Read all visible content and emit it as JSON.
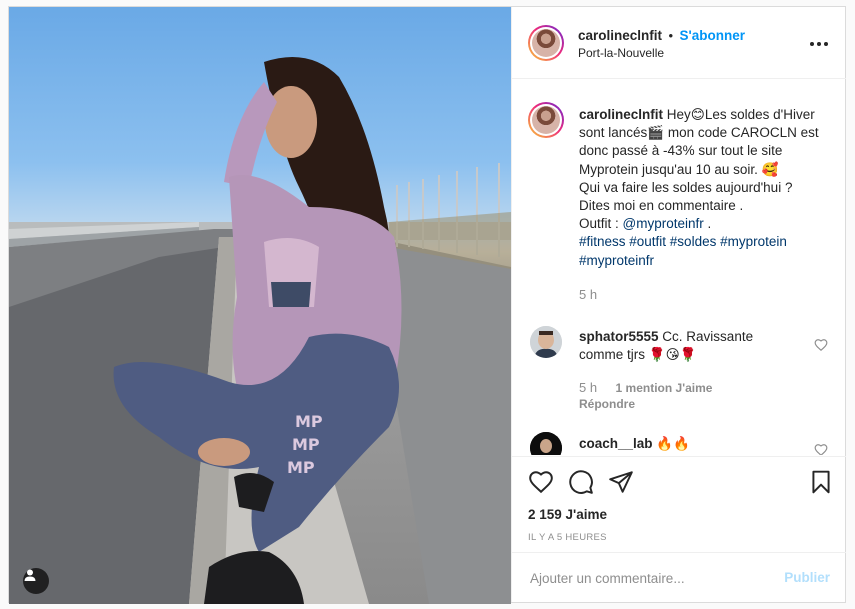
{
  "post": {
    "username": "carolineclnfit",
    "separator": "•",
    "follow_label": "S'abonner",
    "location": "Port-la-Nouvelle"
  },
  "caption": {
    "username": "carolineclnfit",
    "line1": " Hey😊Les soldes d'Hiver sont lancés🎬 mon code CAROCLN est donc passé à -43% sur tout le site Myprotein jusqu'au 10 au soir. 🥰",
    "line2": "Qui va faire les soldes aujourd'hui ?",
    "line3": "Dites moi en commentaire .",
    "outfit_label": "Outfit : ",
    "outfit_mention": "@myproteinfr",
    "outfit_end": " .",
    "hashtags1": "#fitness #outfit #soldes #myprotein",
    "hashtags2": "#myproteinfr",
    "time": "5 h"
  },
  "comments": [
    {
      "username": "sphator5555",
      "text": " Cc. Ravissante comme tjrs 🌹😘🌹",
      "time": "5 h",
      "likes": "1 mention J'aime",
      "reply": "Répondre"
    },
    {
      "username": "coach__lab",
      "text": " 🔥🔥"
    }
  ],
  "actions": {
    "like_icon": "heart-icon",
    "comment_icon": "comment-icon",
    "share_icon": "share-icon",
    "save_icon": "bookmark-icon",
    "likes_count": "2 159 J'aime",
    "posted_ago": "IL Y A 5 HEURES"
  },
  "add_comment": {
    "placeholder": "Ajouter un commentaire...",
    "publish_label": "Publier"
  },
  "colors": {
    "link_blue": "#0095f6",
    "hashtag": "#00376b",
    "muted": "#8e8e8e",
    "publish_disabled": "#b2dffc"
  }
}
